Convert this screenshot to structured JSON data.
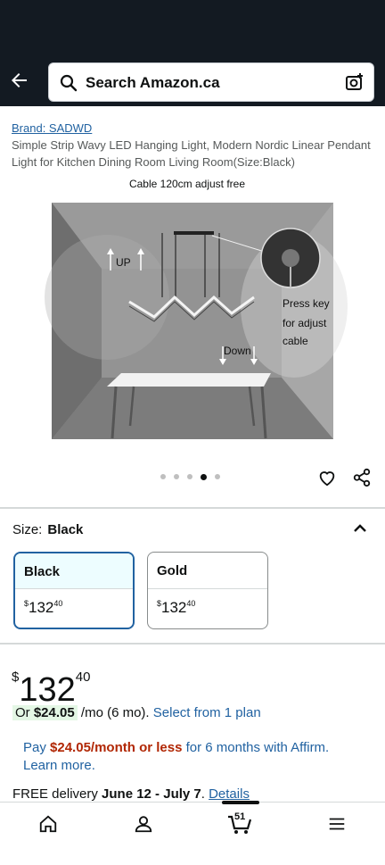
{
  "search": {
    "placeholder": "Search Amazon.ca"
  },
  "product": {
    "brand": "Brand: SADWD",
    "title": "Simple Strip Wavy LED Hanging Light, Modern Nordic Linear Pendant Light for Kitchen Dining Room Living Room(Size:Black)",
    "image_caption": "Cable 120cm adjust free",
    "image_labels": {
      "up": "UP",
      "down": "Down",
      "press_key": [
        "Press key",
        "for adjust",
        "cable"
      ]
    },
    "carousel": {
      "count": 5,
      "active_index": 3
    }
  },
  "size": {
    "label": "Size:",
    "selected": "Black",
    "options": [
      {
        "name": "Black",
        "currency": "$",
        "whole": "132",
        "fraction": "40"
      },
      {
        "name": "Gold",
        "currency": "$",
        "whole": "132",
        "fraction": "40"
      }
    ]
  },
  "price": {
    "currency": "$",
    "whole": "132",
    "fraction": "40"
  },
  "installment": {
    "prefix": "Or",
    "amount": "$24.05",
    "suffix": "/mo (6 mo).",
    "link": "Select from 1 plan"
  },
  "affirm": {
    "pay": "Pay",
    "amount": "$24.05/month or less",
    "rest": "for 6 months with Affirm.",
    "link": "Learn more."
  },
  "delivery": {
    "prefix": "FREE delivery",
    "dates": "June 12 - July 7",
    "sep": ".",
    "link": "Details"
  },
  "nav": {
    "cart_count": "51"
  },
  "colors": {
    "header": "#131a22",
    "link": "#2162a1",
    "price_red": "#b12704",
    "selected_border": "#2162a1"
  }
}
